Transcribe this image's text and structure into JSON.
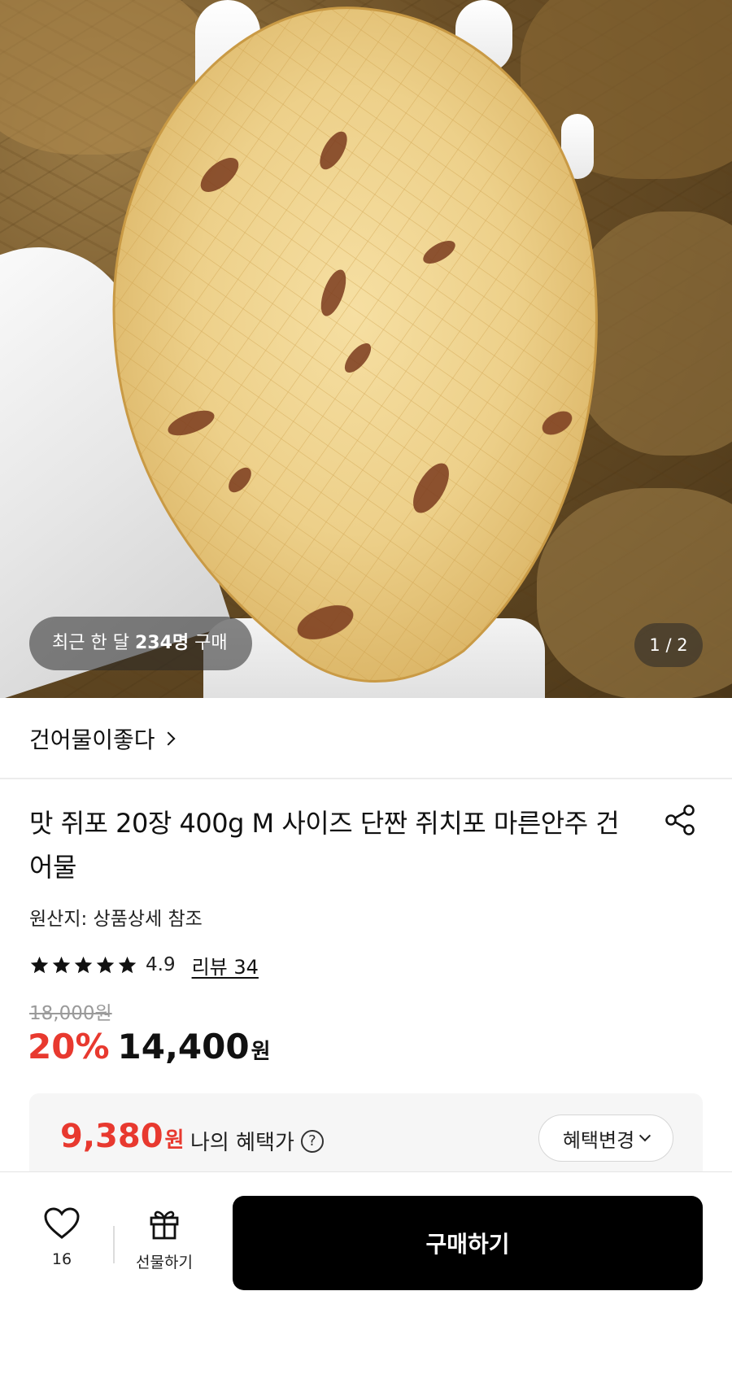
{
  "hero": {
    "badge_prefix": "최근 한 달 ",
    "badge_count": "234명",
    "badge_suffix": " 구매",
    "page_indicator": "1 / 2"
  },
  "store": {
    "name": "건어물이좋다"
  },
  "product": {
    "title": "맛 쥐포 20장 400g M 사이즈 단짠 쥐치포 마른안주 건어물",
    "origin": "원산지: 상품상세 참조",
    "rating": "4.9",
    "stars_filled": 5,
    "review_link": "리뷰 34",
    "original_price": "18,000원",
    "discount": "20%",
    "sale_price": "14,400",
    "sale_unit": "원"
  },
  "benefit": {
    "price": "9,380",
    "unit": "원",
    "label": "나의 혜택가",
    "help_symbol": "?",
    "change_label": "혜택변경"
  },
  "bottom_bar": {
    "like_count": "16",
    "gift_label": "선물하기",
    "buy_label": "구매하기"
  },
  "colors": {
    "accent_red": "#e8392f",
    "buy_button": "#000000"
  }
}
